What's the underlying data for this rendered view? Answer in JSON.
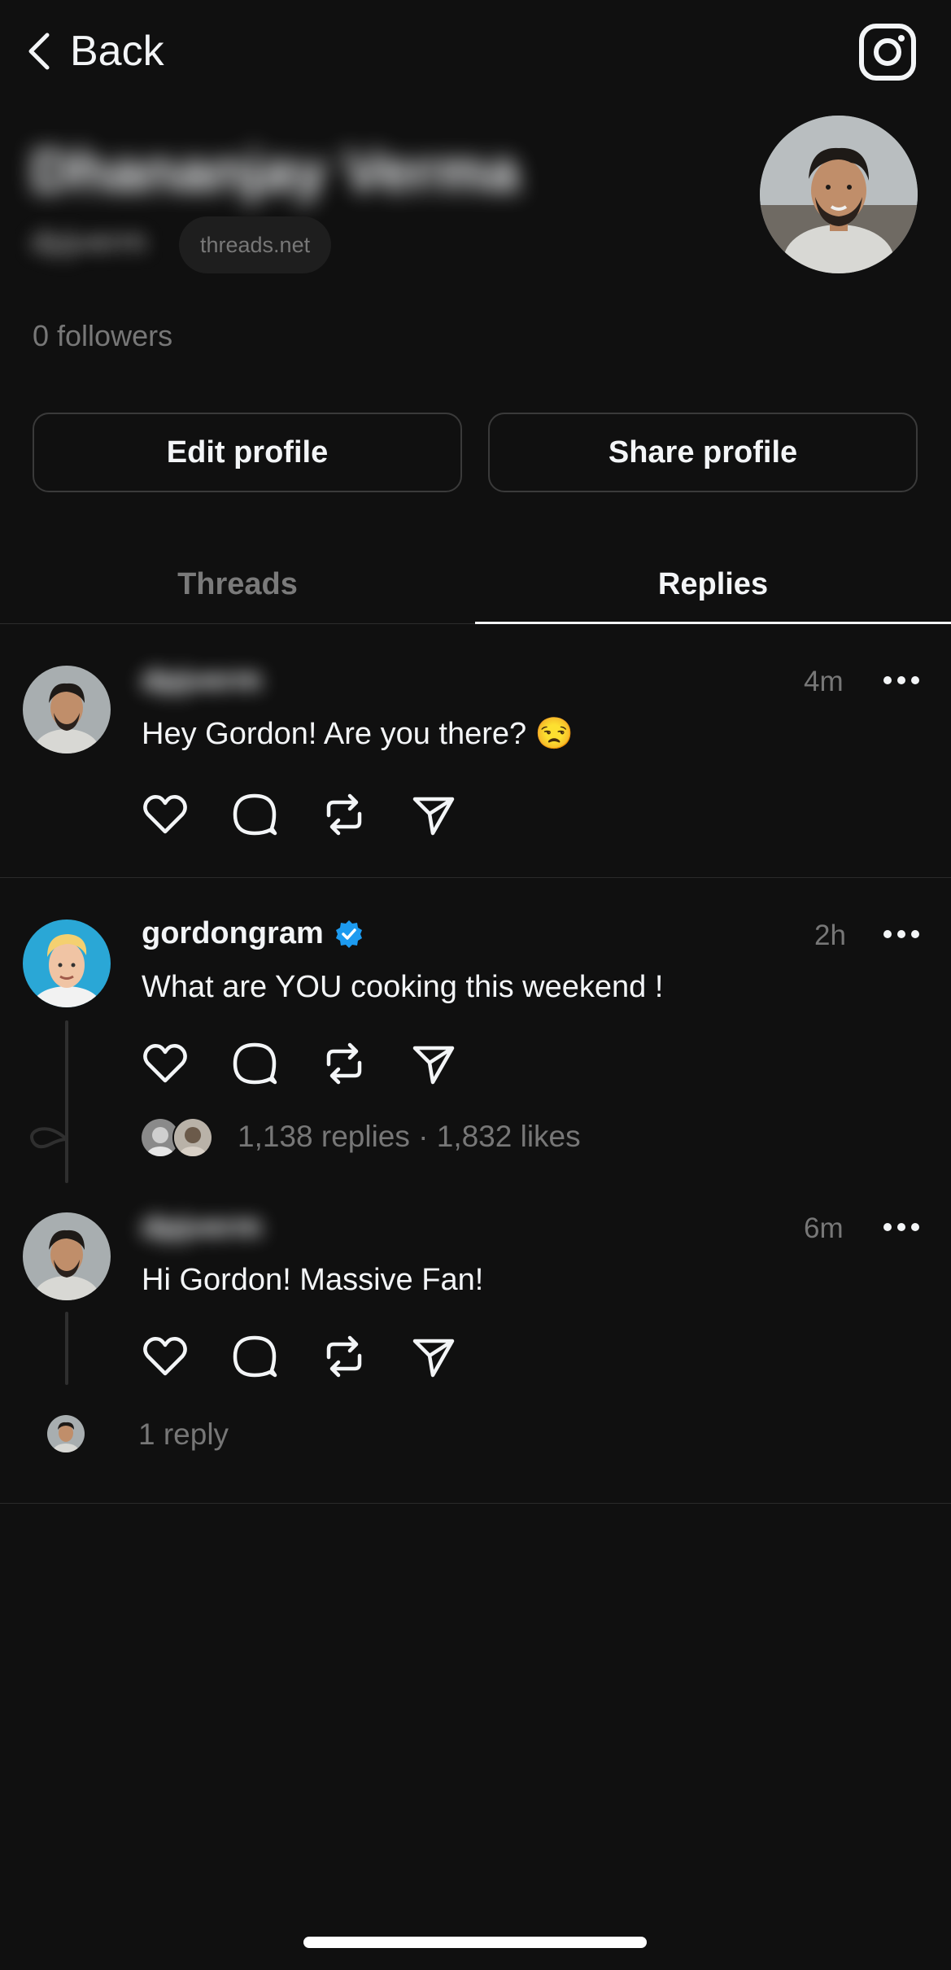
{
  "header": {
    "back_label": "Back",
    "instagram_icon": "instagram-icon"
  },
  "profile": {
    "name": "Dhananjay Verma",
    "handle": "dpjverm",
    "domain": "threads.net",
    "followers": "0 followers",
    "edit_label": "Edit profile",
    "share_label": "Share profile"
  },
  "tabs": [
    {
      "label": "Threads",
      "active": false
    },
    {
      "label": "Replies",
      "active": true
    }
  ],
  "posts": [
    {
      "username": "dpjverm",
      "time": "4m",
      "text": "Hey Gordon! Are you there? 😒"
    },
    {
      "username": "gordongram",
      "verified": true,
      "time": "2h",
      "text": "What are YOU cooking this weekend !",
      "meta": "1,138 replies · 1,832 likes"
    },
    {
      "username": "dpjverm",
      "time": "6m",
      "text": "Hi Gordon! Massive Fan!",
      "meta": "1 reply"
    }
  ],
  "colors": {
    "background": "#101010",
    "text": "#f3f5f7",
    "muted": "#777777",
    "verified": "#1d9bf0"
  }
}
